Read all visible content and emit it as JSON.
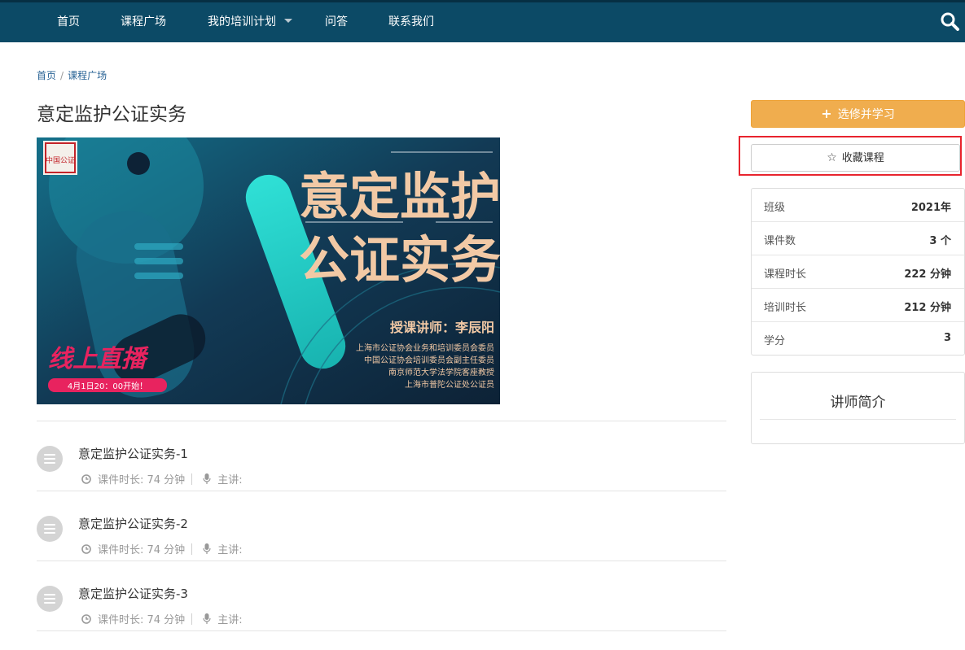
{
  "nav": {
    "items": [
      "首页",
      "课程广场",
      "我的培训计划",
      "问答",
      "联系我们"
    ],
    "bg_color": "#0c4a66"
  },
  "breadcrumb": {
    "home": "首页",
    "current": "课程广场",
    "separator": "/"
  },
  "course": {
    "title": "意定监护公证实务",
    "cover": {
      "headline_line1": "意定监护",
      "headline_line2": "公证实务",
      "seal_text": "中国公证",
      "lecturer": "授课讲师：李辰阳",
      "bio": [
        "上海市公证协会业务和培训委员会委员",
        "中国公证协会培训委员会副主任委员",
        "南京师范大学法学院客座教授",
        "上海市普陀公证处公证员"
      ],
      "live_label": "线上直播",
      "live_time": "4月1日20：00开始！"
    }
  },
  "lessons": [
    {
      "title": "意定监护公证实务-1",
      "duration_label": "课件时长: 74 分钟",
      "speaker_label": "主讲:"
    },
    {
      "title": "意定监护公证实务-2",
      "duration_label": "课件时长: 74 分钟",
      "speaker_label": "主讲:"
    },
    {
      "title": "意定监护公证实务-3",
      "duration_label": "课件时长: 74 分钟",
      "speaker_label": "主讲:"
    }
  ],
  "sidebar": {
    "enroll_label": "选修并学习",
    "favorite_label": "收藏课程",
    "accent_color": "#f0ad4e",
    "highlight_color": "#e8242e",
    "info": [
      {
        "label": "班级",
        "value": "2021年"
      },
      {
        "label": "课件数",
        "value": "3 个"
      },
      {
        "label": "课程时长",
        "value": "222 分钟"
      },
      {
        "label": "培训时长",
        "value": "212 分钟"
      },
      {
        "label": "学分",
        "value": "3"
      }
    ],
    "teacher_title": "讲师简介"
  }
}
